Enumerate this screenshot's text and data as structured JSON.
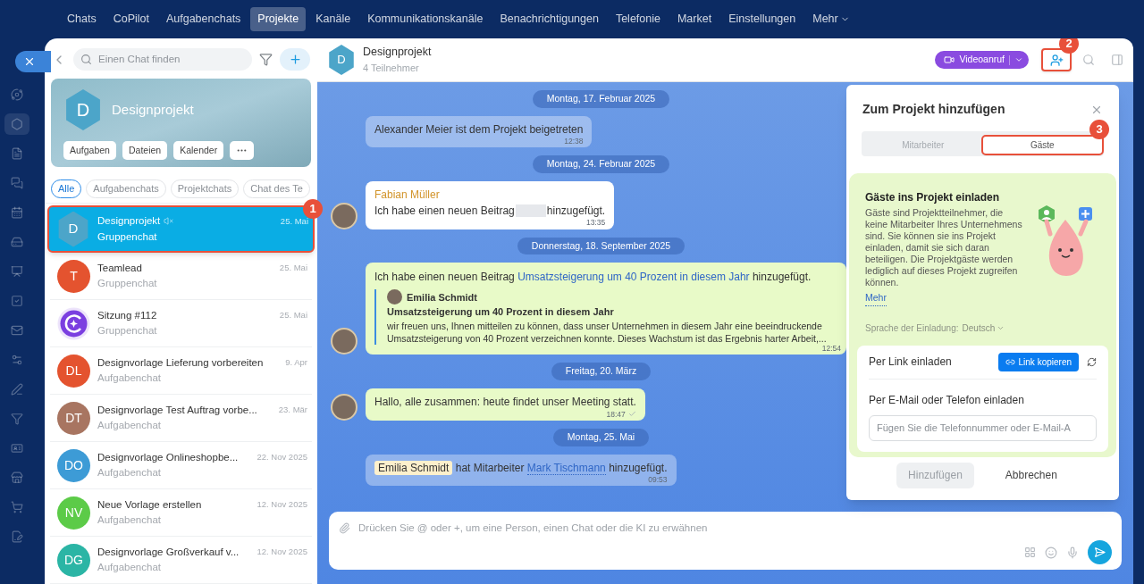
{
  "nav": {
    "tabs": [
      {
        "label": "Chats",
        "selected": false
      },
      {
        "label": "CoPilot",
        "selected": false
      },
      {
        "label": "Aufgabenchats",
        "selected": false
      },
      {
        "label": "Projekte",
        "selected": true
      },
      {
        "label": "Kanäle",
        "selected": false
      },
      {
        "label": "Kommunikationskanäle",
        "selected": false
      },
      {
        "label": "Benachrichtigungen",
        "selected": false
      },
      {
        "label": "Telefonie",
        "selected": false
      },
      {
        "label": "Market",
        "selected": false
      },
      {
        "label": "Einstellungen",
        "selected": false
      }
    ],
    "more": "Mehr"
  },
  "sidebar": {
    "search": {
      "placeholder": "Einen Chat finden"
    },
    "project": {
      "initial": "D",
      "title": "Designprojekt",
      "buttons": [
        "Aufgaben",
        "Dateien",
        "Kalender"
      ]
    },
    "filters": [
      {
        "label": "Alle",
        "selected": true
      },
      {
        "label": "Aufgabenchats",
        "selected": false
      },
      {
        "label": "Projektchats",
        "selected": false
      },
      {
        "label": "Chat des Te",
        "selected": false
      }
    ],
    "chats": [
      {
        "kind": "hexagon",
        "initial": "D",
        "title": "Designprojekt",
        "subtitle": "Gruppenchat",
        "date": "25. Mai",
        "muted": true,
        "selected": true,
        "marker": "1"
      },
      {
        "kind": "circle",
        "initial": "T",
        "title": "Teamlead",
        "subtitle": "Gruppenchat",
        "date": "25. Mai",
        "color": "#e4532f",
        "muted": false,
        "selected": false
      },
      {
        "kind": "logo",
        "title": "Sitzung #112",
        "subtitle": "Gruppenchat",
        "date": "25. Mai",
        "muted": false,
        "selected": false
      },
      {
        "kind": "circle",
        "initial": "DL",
        "title": "Designvorlage Lieferung vorbereiten",
        "subtitle": "Aufgabenchat",
        "date": "9. Apr",
        "color": "#e4532f",
        "muted": false,
        "selected": false
      },
      {
        "kind": "circle",
        "initial": "DT",
        "title": "Designvorlage Test Auftrag vorbe...",
        "subtitle": "Aufgabenchat",
        "date": "23. Mär",
        "color": "#a87561",
        "muted": false,
        "selected": false
      },
      {
        "kind": "circle",
        "initial": "DO",
        "title": "Designvorlage Onlineshopbe...",
        "subtitle": "Aufgabenchat",
        "date": "22. Nov 2025",
        "color": "#3d9bd6",
        "muted": false,
        "selected": false
      },
      {
        "kind": "circle",
        "initial": "NV",
        "title": "Neue Vorlage erstellen",
        "subtitle": "Aufgabenchat",
        "date": "12. Nov 2025",
        "color": "#5ccb48",
        "muted": false,
        "selected": false
      },
      {
        "kind": "circle",
        "initial": "DG",
        "title": "Designvorlage Großverkauf v...",
        "subtitle": "Aufgabenchat",
        "date": "12. Nov 2025",
        "color": "#2bb5a5",
        "muted": false,
        "selected": false
      }
    ]
  },
  "header": {
    "initial": "D",
    "title": "Designprojekt",
    "subtitle": "4 Teilnehmer",
    "video_button": "Videoanruf",
    "add_marker": "2"
  },
  "messages": [
    {
      "kind": "date",
      "text": "Montag, 17. Februar 2025"
    },
    {
      "kind": "system",
      "text": "Alexander Meier ist dem Projekt beigetreten",
      "time": "12:38"
    },
    {
      "kind": "date",
      "text": "Montag, 24. Februar 2025"
    },
    {
      "kind": "incoming",
      "sender": "Fabian Müller",
      "text_before": "Ich habe einen neuen Beitrag",
      "text_after": "hinzugefügt.",
      "time": "13:35"
    },
    {
      "kind": "date",
      "text": "Donnerstag, 18. September 2025"
    },
    {
      "kind": "post",
      "text_before": "Ich habe einen neuen Beitrag",
      "link": "Umsatzsteigerung um 40 Prozent in diesem Jahr",
      "text_after": "hinzugefügt.",
      "quote_author": "Emilia Schmidt",
      "quote_title": "Umsatzsteigerung um 40 Prozent in diesem Jahr",
      "quote_text": "wir freuen uns, Ihnen mitteilen zu können, dass unser Unternehmen in diesem Jahr eine beeindruckende Umsatzsteigerung von 40 Prozent verzeichnen konnte. Dieses Wachstum ist das Ergebnis harter Arbeit,...",
      "time": "12:54"
    },
    {
      "kind": "date",
      "text": "Freitag, 20. März"
    },
    {
      "kind": "own",
      "text": "Hallo, alle zusammen: heute findet unser Meeting statt.",
      "time": "18:47",
      "delivered": true
    },
    {
      "kind": "date",
      "text": "Montag, 25. Mai"
    },
    {
      "kind": "mention",
      "mention": "Emilia Schmidt",
      "text_middle": "hat Mitarbeiter",
      "link": "Mark Tischmann",
      "text_after": "hinzugefügt.",
      "time": "09:53"
    }
  ],
  "composer": {
    "placeholder": "Drücken Sie @ oder +, um eine Person, einen Chat oder die KI zu erwähnen"
  },
  "dialog": {
    "title": "Zum Projekt hinzufügen",
    "tabs": [
      {
        "label": "Mitarbeiter",
        "selected": false
      },
      {
        "label": "Gäste",
        "selected": true,
        "marker": "3"
      }
    ],
    "promo": {
      "title": "Gäste ins Projekt einladen",
      "text": "Gäste sind Projektteilnehmer, die keine Mitarbeiter Ihres Unternehmens sind. Sie können sie ins Projekt einladen, damit sie sich daran beteiligen. Die Projektgäste werden lediglich auf dieses Projekt zugreifen können.",
      "link": "Mehr"
    },
    "language": {
      "label": "Sprache der Einladung:",
      "value": "Deutsch"
    },
    "link_invite": {
      "label": "Per Link einladen",
      "button": "Link kopieren"
    },
    "email_invite": {
      "label": "Per E-Mail oder Telefon einladen",
      "placeholder": "Fügen Sie die Telefonnummer oder E-Mail-A"
    },
    "buttons": [
      {
        "label": "Hinzufügen",
        "kind": "primary",
        "disabled": true
      },
      {
        "label": "Abbrechen",
        "kind": "secondary",
        "disabled": false
      }
    ]
  }
}
